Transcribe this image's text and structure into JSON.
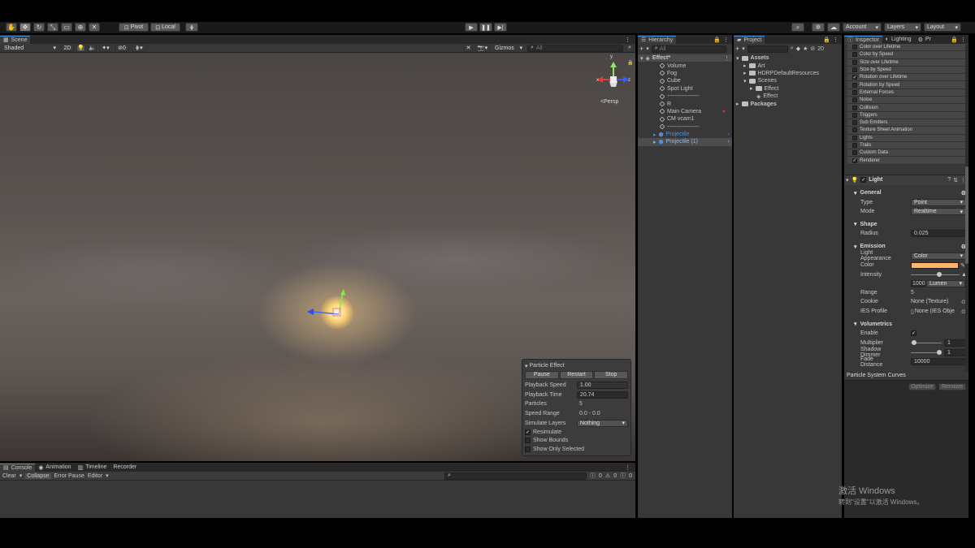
{
  "toolbar": {
    "pivot_label": "Pivot",
    "local_label": "Local",
    "account_label": "Account",
    "layers_label": "Layers",
    "layout_label": "Layout"
  },
  "scene": {
    "tab_label": "Scene",
    "shading_mode": "Shaded",
    "mode_2d": "2D",
    "hidden_count": "0",
    "gizmos_label": "Gizmos",
    "search_placeholder": "All",
    "persp_label": "<Persp",
    "axis_x": "x",
    "axis_y": "y",
    "axis_z": "z"
  },
  "particle_effect": {
    "title": "Particle Effect",
    "pause_label": "Pause",
    "restart_label": "Restart",
    "stop_label": "Stop",
    "playback_speed_label": "Playback Speed",
    "playback_speed_value": "1.00",
    "playback_time_label": "Playback Time",
    "playback_time_value": "20.74",
    "particles_label": "Particles",
    "particles_value": "5",
    "speed_range_label": "Speed Range",
    "speed_range_value": "0.0 - 0.0",
    "simulate_layers_label": "Simulate Layers",
    "simulate_layers_value": "Nothing",
    "resimulate_label": "Resimulate",
    "show_bounds_label": "Show Bounds",
    "show_only_selected_label": "Show Only Selected"
  },
  "console": {
    "tabs": [
      "Console",
      "Animation",
      "Timeline",
      "Recorder"
    ],
    "clear_label": "Clear",
    "collapse_label": "Collapse",
    "error_pause_label": "Error Pause",
    "editor_label": "Editor",
    "count_warn": "0",
    "count_err": "0"
  },
  "hierarchy": {
    "tab_label": "Hierarchy",
    "search_placeholder": "All",
    "scene_name": "Effect*",
    "items": [
      "Volume",
      "Fog",
      "Cube",
      "Spot Light",
      "-----------------",
      "R",
      "Main Camera",
      "CM vcam1",
      "-----------------",
      "Projectile",
      "Projectile (1)"
    ]
  },
  "project": {
    "tab_label": "Project",
    "hidden_count": "20",
    "assets_label": "Assets",
    "art_label": "Art",
    "hdrp_label": "HDRPDefaultResources",
    "scenes_label": "Scenes",
    "effect_folder_label": "Effect",
    "effect_scene_label": "Effect",
    "packages_label": "Packages"
  },
  "inspector": {
    "tab_label": "Inspector",
    "lighting_tab_label": "Lighting",
    "third_tab_label": "Pr",
    "modules": [
      {
        "label": "Color over Lifetime",
        "checked": false
      },
      {
        "label": "Color by Speed",
        "checked": false
      },
      {
        "label": "Size over Lifetime",
        "checked": false
      },
      {
        "label": "Size by Speed",
        "checked": false
      },
      {
        "label": "Rotation over Lifetime",
        "checked": true
      },
      {
        "label": "Rotation by Speed",
        "checked": false
      },
      {
        "label": "External Forces",
        "checked": false
      },
      {
        "label": "Noise",
        "checked": false
      },
      {
        "label": "Collision",
        "checked": false
      },
      {
        "label": "Triggers",
        "checked": false
      },
      {
        "label": "Sub Emitters",
        "checked": false
      },
      {
        "label": "Texture Sheet Animation",
        "checked": false
      },
      {
        "label": "Lights",
        "checked": false
      },
      {
        "label": "Trails",
        "checked": false
      },
      {
        "label": "Custom Data",
        "checked": false
      },
      {
        "label": "Renderer",
        "checked": true
      }
    ],
    "light_component_label": "Light",
    "general_label": "General",
    "type_label": "Type",
    "type_value": "Point",
    "mode_label": "Mode",
    "mode_value": "Realtime",
    "shape_label": "Shape",
    "radius_label": "Radius",
    "radius_value": "0.025",
    "emission_label": "Emission",
    "light_appearance_label": "Light Appearance",
    "light_appearance_value": "Color",
    "color_label": "Color",
    "color_value": "#FFB36B",
    "intensity_label": "Intensity",
    "intensity_value": "1000",
    "intensity_unit": "Lumen",
    "range_label": "Range",
    "range_value": "5",
    "cookie_label": "Cookie",
    "cookie_value": "None (Texture)",
    "ies_label": "IES Profile",
    "ies_value": "None (IES Obje",
    "volumetrics_label": "Volumetrics",
    "enable_label": "Enable",
    "multiplier_label": "Multiplier",
    "multiplier_value": "1",
    "shadow_dimmer_label": "Shadow Dimmer",
    "shadow_dimmer_value": "1",
    "fade_distance_label": "Fade Distance",
    "fade_distance_value": "10000",
    "curves_label": "Particle System Curves",
    "optimize_label": "Optimize",
    "remove_label": "Remove"
  },
  "watermark": {
    "line1": "激活 Windows",
    "line2": "转到\"设置\"以激活 Windows。"
  }
}
